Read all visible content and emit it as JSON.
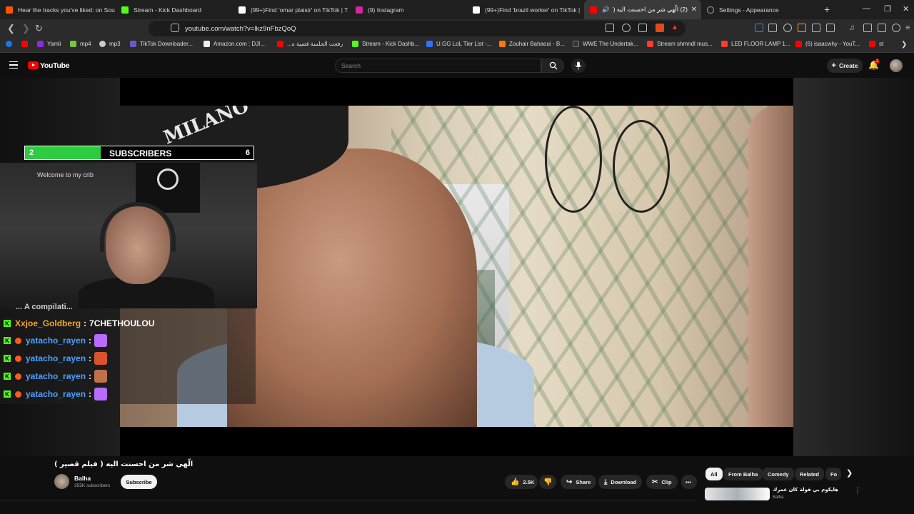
{
  "tabs": [
    {
      "title": "Hear the tracks you've liked: on Sou",
      "color": "#ff5500",
      "active": false
    },
    {
      "title": "Stream - Kick Dashboard",
      "color": "#53fc18",
      "active": false
    },
    {
      "title": "(99+)Find 'omar plaisir' on TikTok | T",
      "color": "#ffffff",
      "active": false
    },
    {
      "title": "(9) Instagram",
      "color": "#d6249f",
      "active": false
    },
    {
      "title": "(99+)Find 'brazil worker' on TikTok |",
      "color": "#ffffff",
      "active": false
    },
    {
      "title": "(2) الّهي شر من احسنت اليه (",
      "color": "#ff0000",
      "active": true
    },
    {
      "title": "Settings - Appearance",
      "color": "#aaaaaa",
      "active": false
    }
  ],
  "address": {
    "url": "youtube.com/watch?v=lkz9nFbzQoQ"
  },
  "bookmarks": [
    {
      "label": "Yamli",
      "color": "#8a2be2"
    },
    {
      "label": "mp4",
      "color": "#7ec242"
    },
    {
      "label": "mp3",
      "color": "#cccccc"
    },
    {
      "label": "TikTok Downloader...",
      "color": "#6a5acd"
    },
    {
      "label": "Amazon.com : DJI...",
      "color": "#eeeeee"
    },
    {
      "label": "رفعت الجلسة قضية ه...",
      "color": "#ff0000"
    },
    {
      "label": "Stream - Kick Dashb...",
      "color": "#53fc18"
    },
    {
      "label": "U.GG LoL Tier List -...",
      "color": "#3273fa"
    },
    {
      "label": "Zouhair Bahaoui - B...",
      "color": "#ff7a00"
    },
    {
      "label": "WWE The Undertak...",
      "color": "#333333"
    },
    {
      "label": "Stream shmndl mus...",
      "color": "#ff3b30"
    },
    {
      "label": "LED FLOOR LAMP 1...",
      "color": "#ff3b30"
    },
    {
      "label": "(6) isaacwhy - YouT...",
      "color": "#ff0000"
    },
    {
      "label": "st",
      "color": "#ff0000"
    }
  ],
  "youtube": {
    "logo": "YouTube",
    "search_placeholder": "Search",
    "create_label": "Create",
    "notif_count": "2"
  },
  "overlay": {
    "subs_current": "2",
    "subs_label": "SUBSCRIBERS",
    "subs_goal": "6",
    "subs_progress": 0.33,
    "cam_wall_text": "Welcome to my crib",
    "chat_cut_text": "... A compilati...",
    "chat": [
      {
        "user": "Xxjoe_Goldberg",
        "message": "7CHETHOULOU",
        "user_color": "#f5a623",
        "emote": ""
      },
      {
        "user": "yatacho_rayen",
        "message": "",
        "user_color": "#4ea0ff",
        "emote": "#b86bff"
      },
      {
        "user": "yatacho_rayen",
        "message": "",
        "user_color": "#4ea0ff",
        "emote": "#d9532c"
      },
      {
        "user": "yatacho_rayen",
        "message": "",
        "user_color": "#4ea0ff",
        "emote": "#c0704a"
      },
      {
        "user": "yatacho_rayen",
        "message": "",
        "user_color": "#4ea0ff",
        "emote": "#b86bff"
      }
    ]
  },
  "video": {
    "title": "الّهي شر من احسنت اليه ( فيلم قصير )",
    "channel": "Balha",
    "subscribers": "355K subscribers",
    "subscribe_label": "Subscribe",
    "likes": "2.5K",
    "share_label": "Share",
    "download_label": "Download",
    "clip_label": "Clip"
  },
  "chips": [
    "All",
    "From Balha",
    "Comedy",
    "Related",
    "Fo"
  ],
  "recommended": {
    "title": "هايكوم بي قولة كان عمرك",
    "channel": "Balha"
  },
  "icons": {
    "back": "arrow-left-icon",
    "forward": "arrow-right-icon",
    "reload": "reload-icon",
    "bookmark": "bookmark-icon",
    "search": "search-icon",
    "mic": "mic-icon",
    "bell": "bell-icon",
    "like": "thumbs-up-icon",
    "dislike": "thumbs-down-icon",
    "share": "share-icon",
    "download": "download-icon",
    "clip": "scissors-icon",
    "more": "more-icon"
  }
}
